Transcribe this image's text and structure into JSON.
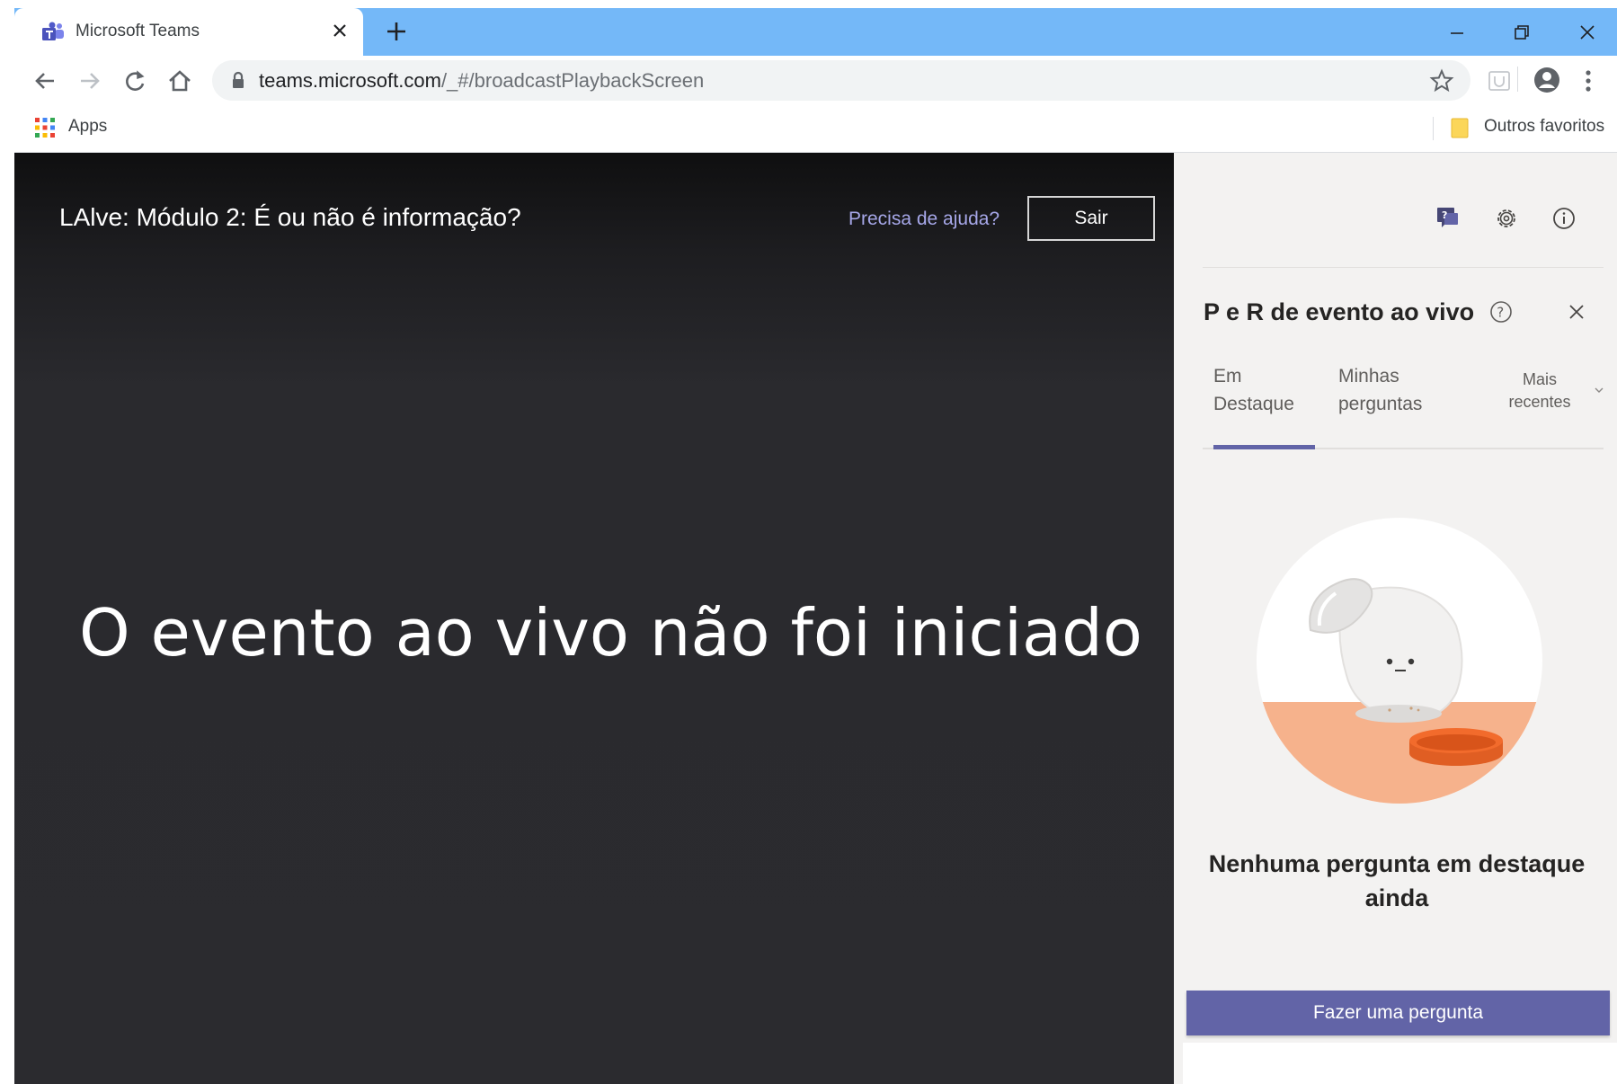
{
  "browser": {
    "tab": {
      "title": "Microsoft Teams",
      "favicon": "teams-icon"
    },
    "address": {
      "host": "teams.microsoft.com",
      "path": "/_#/broadcastPlaybackScreen"
    },
    "bookmarks": {
      "apps_label": "Apps",
      "other_label": "Outros favoritos"
    },
    "accent": "#74b8f8"
  },
  "player": {
    "event_title": "LAlve: Módulo 2: É ou não é informação?",
    "help_link": "Precisa de ajuda?",
    "exit_label": "Sair",
    "status_message": "O evento ao vivo não foi iniciado"
  },
  "qa_panel": {
    "title": "P e R de evento ao vivo",
    "tabs": [
      {
        "line1": "Em",
        "line2": "Destaque",
        "active": true
      },
      {
        "line1": "Minhas",
        "line2": "perguntas",
        "active": false
      }
    ],
    "sort": {
      "line1": "Mais",
      "line2": "recentes"
    },
    "empty_message": "Nenhuma pergunta em destaque ainda",
    "ask_button": "Fazer uma pergunta",
    "accent": "#6264a7"
  },
  "icons": {
    "toolbar": [
      "back-arrow-icon",
      "forward-arrow-icon",
      "reload-icon",
      "home-icon",
      "lock-icon",
      "star-icon",
      "extension-icon",
      "profile-icon",
      "menu-dots-icon"
    ],
    "panel": [
      "qa-icon",
      "gear-icon",
      "info-icon",
      "help-circle-icon",
      "close-icon",
      "chevron-down-icon"
    ]
  }
}
